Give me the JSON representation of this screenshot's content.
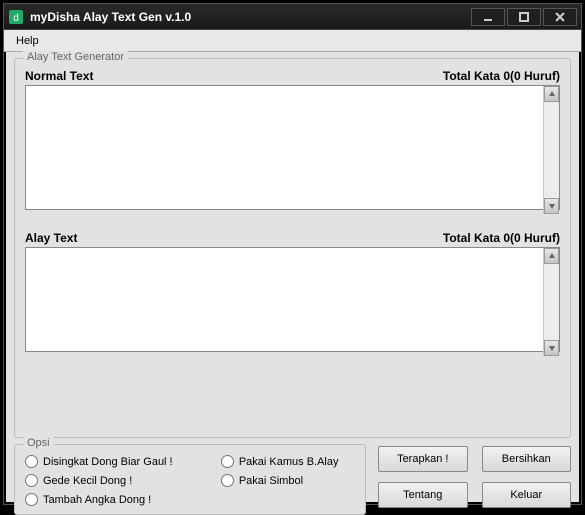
{
  "window": {
    "title": "myDisha Alay Text Gen v.1.0"
  },
  "menubar": {
    "help": "Help"
  },
  "group": {
    "title": "Alay Text Generator"
  },
  "normal": {
    "label": "Normal Text",
    "counter": "Total Kata 0(0 Huruf)",
    "value": ""
  },
  "alay": {
    "label": "Alay Text",
    "counter": "Total Kata 0(0 Huruf)",
    "value": ""
  },
  "opsi": {
    "legend": "Opsi",
    "options": {
      "disingkat": "Disingkat Dong Biar Gaul !",
      "pakai_kamus": "Pakai Kamus B.Alay",
      "gede_kecil": "Gede Kecil Dong !",
      "pakai_simbol": "Pakai Simbol",
      "tambah_angka": "Tambah Angka Dong !"
    }
  },
  "buttons": {
    "terapkan": "Terapkan !",
    "bersihkan": "Bersihkan",
    "tentang": "Tentang",
    "keluar": "Keluar"
  }
}
